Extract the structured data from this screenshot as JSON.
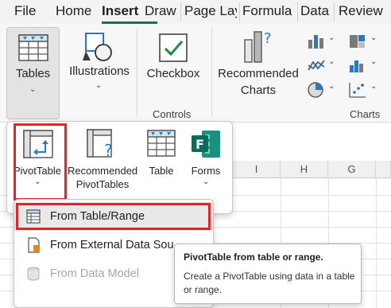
{
  "tabs": [
    "File",
    "Home",
    "Insert",
    "Draw",
    "Page Lay",
    "Formula",
    "Data",
    "Review"
  ],
  "active_tab": "Insert",
  "ribbon": {
    "tables_label": "Tables",
    "illustrations_label": "Illustrations",
    "checkbox_label": "Checkbox",
    "controls_group": "Controls",
    "recommended_charts_line1": "Recommended",
    "recommended_charts_line2": "Charts",
    "charts_group": "Charts"
  },
  "sheet": {
    "columns": [
      "I",
      "H",
      "G"
    ]
  },
  "tables_menu": {
    "pivottable_label": "PivotTable",
    "recommended_pivot_line1": "Recommended",
    "recommended_pivot_line2": "PivotTables",
    "table_label": "Table",
    "forms_label": "Forms"
  },
  "pivot_submenu": {
    "items": [
      {
        "label": "From Table/Range",
        "enabled": true,
        "hovered": true
      },
      {
        "label": "From External Data Sou",
        "enabled": true,
        "hovered": false
      },
      {
        "label": "From Data Model",
        "enabled": false,
        "hovered": false
      }
    ]
  },
  "tooltip": {
    "title": "PivotTable from table or range.",
    "body": "Create a PivotTable using data in a table or range."
  },
  "colors": {
    "accent_green": "#1e7145",
    "highlight_red": "#e0242b",
    "forms_teal": "#0b6a5e"
  }
}
